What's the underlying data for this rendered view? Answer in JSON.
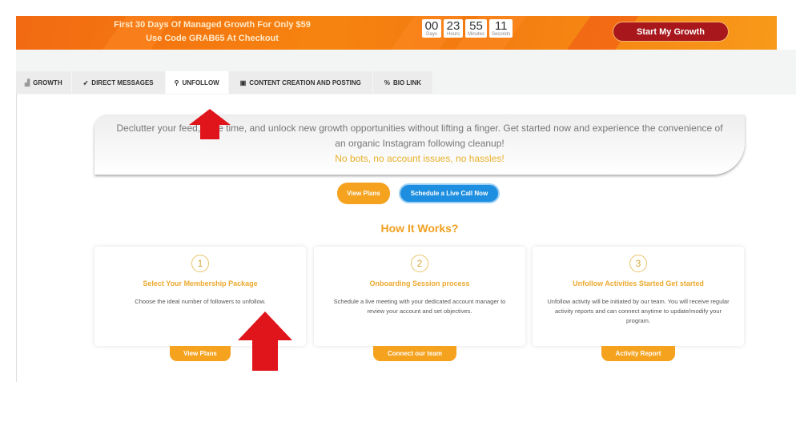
{
  "banner": {
    "line1": "First 30 Days Of Managed Growth For Only $59",
    "line2": "Use Code GRAB65 At Checkout",
    "timer": [
      {
        "value": "00",
        "label": "Days"
      },
      {
        "value": "23",
        "label": "Hours"
      },
      {
        "value": "55",
        "label": "Minutes"
      },
      {
        "value": "11",
        "label": "Seconds"
      }
    ],
    "cta": "Start My Growth"
  },
  "tabs": [
    {
      "label": "GROWTH",
      "icon": "chart-icon"
    },
    {
      "label": "DIRECT MESSAGES",
      "icon": "send-icon"
    },
    {
      "label": "UNFOLLOW",
      "icon": "user-minus-icon",
      "active": true
    },
    {
      "label": "CONTENT CREATION AND POSTING",
      "icon": "document-icon"
    },
    {
      "label": "BIO LINK",
      "icon": "link-icon"
    }
  ],
  "hero": {
    "text1": "Declutter your feed, save time, and unlock new growth opportunities without lifting a finger. Get started now and experience the convenience of",
    "text2": "an organic Instagram following cleanup!",
    "text3": "No bots, no account issues, no hassles!"
  },
  "actions": {
    "view_plans": "View Plans",
    "schedule": "Schedule a Live Call Now"
  },
  "how_title": "How It Works?",
  "cards": [
    {
      "num": "1",
      "title": "Select Your Membership Package",
      "text": "Choose the ideal number of followers to unfollow.",
      "button": "View Plans"
    },
    {
      "num": "2",
      "title": "Onboarding Session process",
      "text": "Schedule a live meeting with your dedicated account manager to review your account and set objectives.",
      "button": "Connect our team"
    },
    {
      "num": "3",
      "title": "Unfollow Activities Started Get started",
      "text": "Unfollow activity will be initiated by our team. You will receive regular activity reports and can connect anytime to update/modify your program.",
      "button": "Activity Report"
    }
  ],
  "colors": {
    "accent": "#f5a21f",
    "blue": "#1e8fe0",
    "cta": "#a8171c",
    "arrow": "#e0141b"
  }
}
